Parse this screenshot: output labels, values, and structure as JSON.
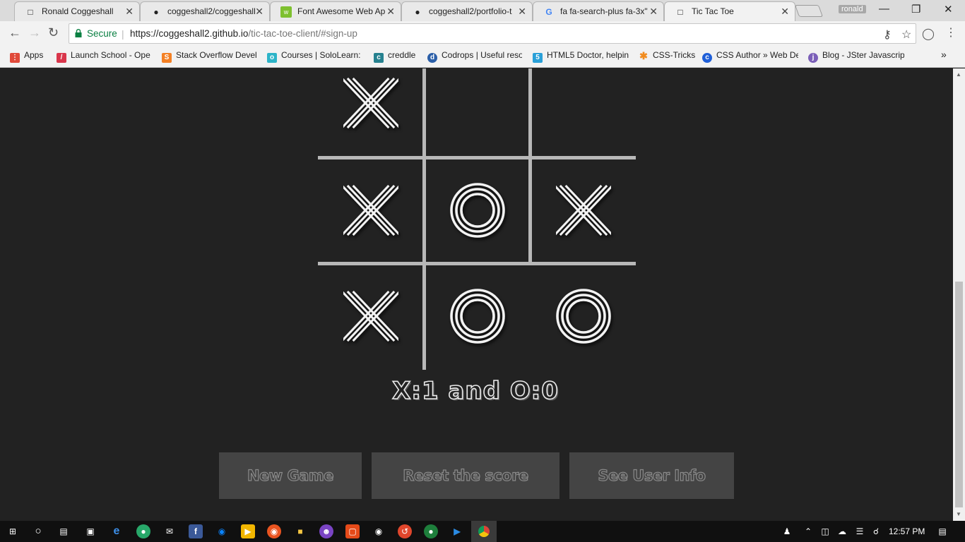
{
  "browser": {
    "tabs": [
      {
        "title": "Ronald Coggeshall",
        "icon": "page-icon"
      },
      {
        "title": "coggeshall2/coggeshall",
        "icon": "github-icon"
      },
      {
        "title": "Font Awesome Web Ap",
        "icon": "font-awesome-icon"
      },
      {
        "title": "coggeshall2/portfolio-t",
        "icon": "github-icon"
      },
      {
        "title": "fa fa-search-plus fa-3x\"",
        "icon": "google-icon"
      },
      {
        "title": "Tic Tac Toe",
        "icon": "page-icon"
      }
    ],
    "profile_name": "ronald",
    "secure_label": "Secure",
    "url_host": "https://coggeshall2.github.io",
    "url_path": "/tic-tac-toe-client/#sign-up"
  },
  "bookmarks": [
    {
      "label": "Apps",
      "icon": "apps-grid-icon",
      "color": "#e04a3a"
    },
    {
      "label": "Launch School - Ope",
      "icon": "launch-school-icon",
      "color": "#d9364b"
    },
    {
      "label": "Stack Overflow Devel",
      "icon": "stack-overflow-icon",
      "color": "#f48024"
    },
    {
      "label": "Courses | SoloLearn: L",
      "icon": "sololearn-icon",
      "color": "#2db4c8"
    },
    {
      "label": "creddle",
      "icon": "creddle-icon",
      "color": "#26818f"
    },
    {
      "label": "Codrops | Useful reso",
      "icon": "codrops-icon",
      "color": "#2b5fa8"
    },
    {
      "label": "HTML5 Doctor, helpin",
      "icon": "html5-doctor-icon",
      "color": "#2aa0d8"
    },
    {
      "label": "CSS-Tricks",
      "icon": "css-tricks-icon",
      "color": "#f18b1e"
    },
    {
      "label": "CSS Author » Web De",
      "icon": "css-author-icon",
      "color": "#1f5fd8"
    },
    {
      "label": "Blog - JSter Javascript",
      "icon": "jster-icon",
      "color": "#7b5fb8"
    }
  ],
  "board": {
    "cells": [
      "X",
      "",
      "",
      "X",
      "O",
      "X",
      "X",
      "O",
      "O"
    ]
  },
  "score": {
    "text": "X:1 and O:0"
  },
  "buttons": {
    "new_game": "New Game",
    "reset_score": "Reset the score",
    "user_info": "See User Info"
  },
  "taskbar": {
    "time": "12:57 PM"
  },
  "colors": {
    "page_bg": "#222222",
    "grid_line": "#b8b8b8",
    "button_bg": "#444444",
    "secure_green": "#0b8043"
  }
}
